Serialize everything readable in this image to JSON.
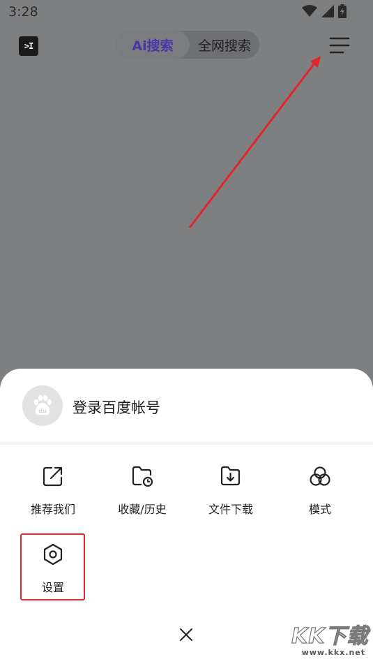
{
  "status_bar": {
    "time": "3:28"
  },
  "top_bar": {
    "app_icon_text": ">I",
    "tab_ai": "Ai搜索",
    "tab_web": "全网搜索"
  },
  "sheet": {
    "login_text": "登录百度帐号",
    "items": [
      {
        "label": "推荐我们",
        "icon": "share-icon"
      },
      {
        "label": "收藏/历史",
        "icon": "folder-clock-icon"
      },
      {
        "label": "文件下载",
        "icon": "folder-download-icon"
      },
      {
        "label": "模式",
        "icon": "circles-icon"
      },
      {
        "label": "设置",
        "icon": "hexagon-settings-icon"
      }
    ]
  },
  "watermark": {
    "logo": "KK下载",
    "url": "www.kkx.net"
  },
  "colors": {
    "highlight": "#e0262a",
    "arrow": "#e0262a",
    "ai_tab_text": "#4a36a8"
  }
}
